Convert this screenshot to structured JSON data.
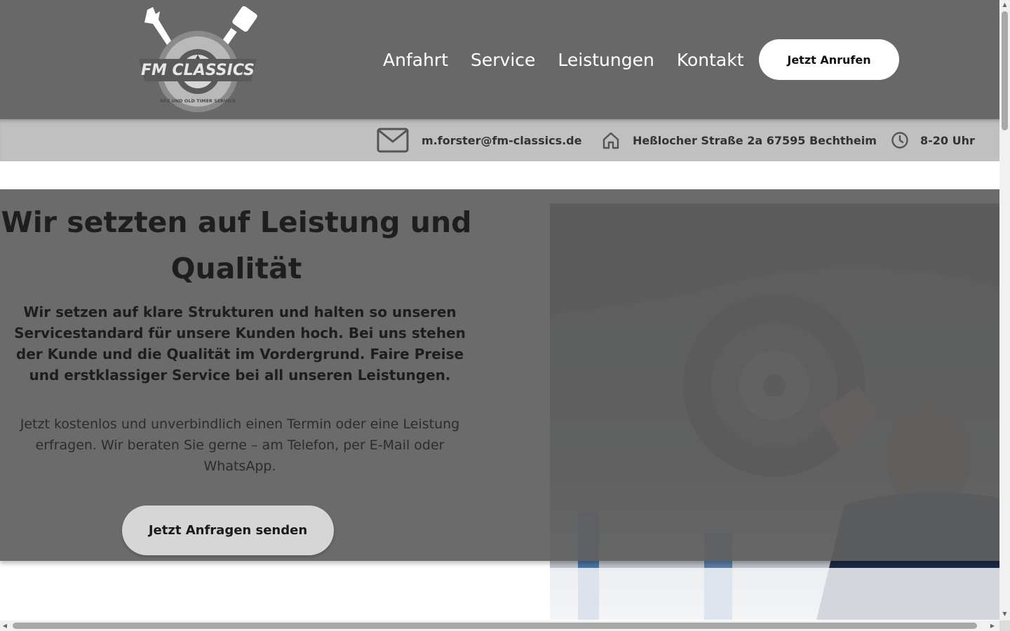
{
  "header": {
    "logo_text": "FM CLASSICS",
    "logo_subtext": "KFZ UND OLD TIMER SERVICE",
    "nav": [
      {
        "label": "Anfahrt"
      },
      {
        "label": "Service"
      },
      {
        "label": "Leistungen"
      },
      {
        "label": "Kontakt"
      }
    ],
    "cta_label": "Jetzt Anrufen"
  },
  "infobar": {
    "email": "m.forster@fm-classics.de",
    "address": "Heßlocher Straße 2a 67595 Bechtheim",
    "hours": "8-20 Uhr"
  },
  "hero": {
    "title_line1": "Wir setzten auf Leistung und",
    "title_line2": "Qualität",
    "lead": "Wir setzen auf klare Strukturen und halten so unseren Servicestandard für unsere Kunden hoch. Bei uns stehen der Kunde und die Qualität im Vordergrund. Faire Preise und erstklassiger Service bei all unseren Leistungen.",
    "sub": "Jetzt kostenlos und unverbindlich einen Termin oder eine Leistung erfragen. Wir beraten Sie gerne – am Telefon, per E-Mail oder WhatsApp.",
    "cta_label": "Jetzt Anfragen senden"
  },
  "colors": {
    "header_bg": "#686868",
    "infobar_bg": "#c0c0c0",
    "hero_overlay": "#606060",
    "cta_bg": "#ffffff"
  }
}
